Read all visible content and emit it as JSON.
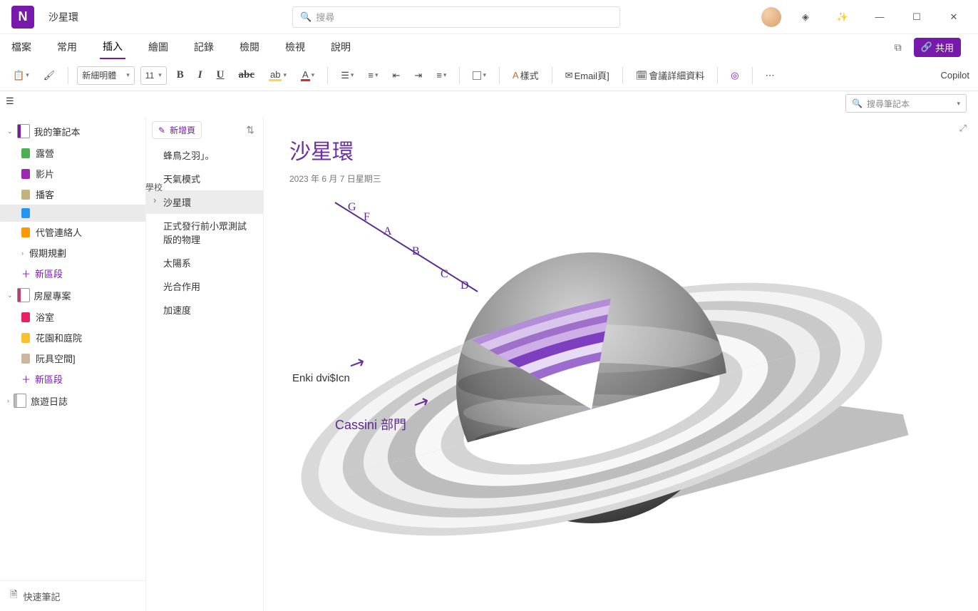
{
  "app": {
    "title": "沙星環",
    "icon_letter": "N"
  },
  "search": {
    "placeholder": "搜尋"
  },
  "titlebar_icons": {
    "premium": "premium-diamond",
    "dictate": "magic-wand"
  },
  "window": {
    "min": "—",
    "max": "☐",
    "close": "✕"
  },
  "ribbon": {
    "tabs": [
      "檔案",
      "常用",
      "插入",
      "繪圖",
      "記錄",
      "檢閱",
      "檢視",
      "說明"
    ],
    "active_index": 2,
    "share": "共用"
  },
  "toolbar": {
    "font_name": "新細明體",
    "font_size": "11",
    "styles": "樣式",
    "email_page": "Email頁]",
    "meeting_details": "會議詳細資料",
    "copilot": "Copilot"
  },
  "search_nb": {
    "placeholder": "搜尋筆記本"
  },
  "sidebar": {
    "notebooks": [
      {
        "name": "我的筆記本",
        "color": "nb-purple",
        "sections": [
          {
            "label": "露營",
            "color": "c-green"
          },
          {
            "label": "影片",
            "color": "c-teal"
          },
          {
            "label": "播客",
            "color": "c-tan"
          },
          {
            "label": "",
            "color": "c-blue",
            "selected": true
          },
          {
            "label": "代管連絡人",
            "color": "c-orange"
          },
          {
            "label": "假期規劃",
            "color": "",
            "chevron": true
          }
        ]
      },
      {
        "name": "房屋專案",
        "color": "nb-rose",
        "sections": [
          {
            "label": "浴室",
            "color": "c-rose"
          },
          {
            "label": "花園和庭院",
            "color": "c-yellow"
          },
          {
            "label": "阮具空間]",
            "color": "c-sand"
          }
        ]
      },
      {
        "name": "旅遊日誌",
        "color": "nb-gray",
        "collapsed": true
      }
    ],
    "new_section": "新區段",
    "quick_notes": "快速筆記"
  },
  "pagelist": {
    "add_page": "新增頁",
    "school_label": "學校",
    "pages": [
      {
        "title": "蜂鳥之羽」。"
      },
      {
        "title": "天氣模式"
      },
      {
        "title": "沙星環",
        "selected": true
      },
      {
        "title": "正式發行前小眾測試版的物理"
      },
      {
        "title": "太陽系"
      },
      {
        "title": "光合作用"
      },
      {
        "title": "加速度"
      }
    ]
  },
  "page": {
    "title": "沙星環",
    "date": "2023 年 6 月 7 日星期三"
  },
  "illustration": {
    "ring_labels": [
      "G",
      "F",
      "A",
      "B",
      "C",
      "D"
    ],
    "annotation1": "Enki dvi$Icn",
    "annotation2_prefix": "Cassini ",
    "annotation2_suffix": "部門"
  }
}
